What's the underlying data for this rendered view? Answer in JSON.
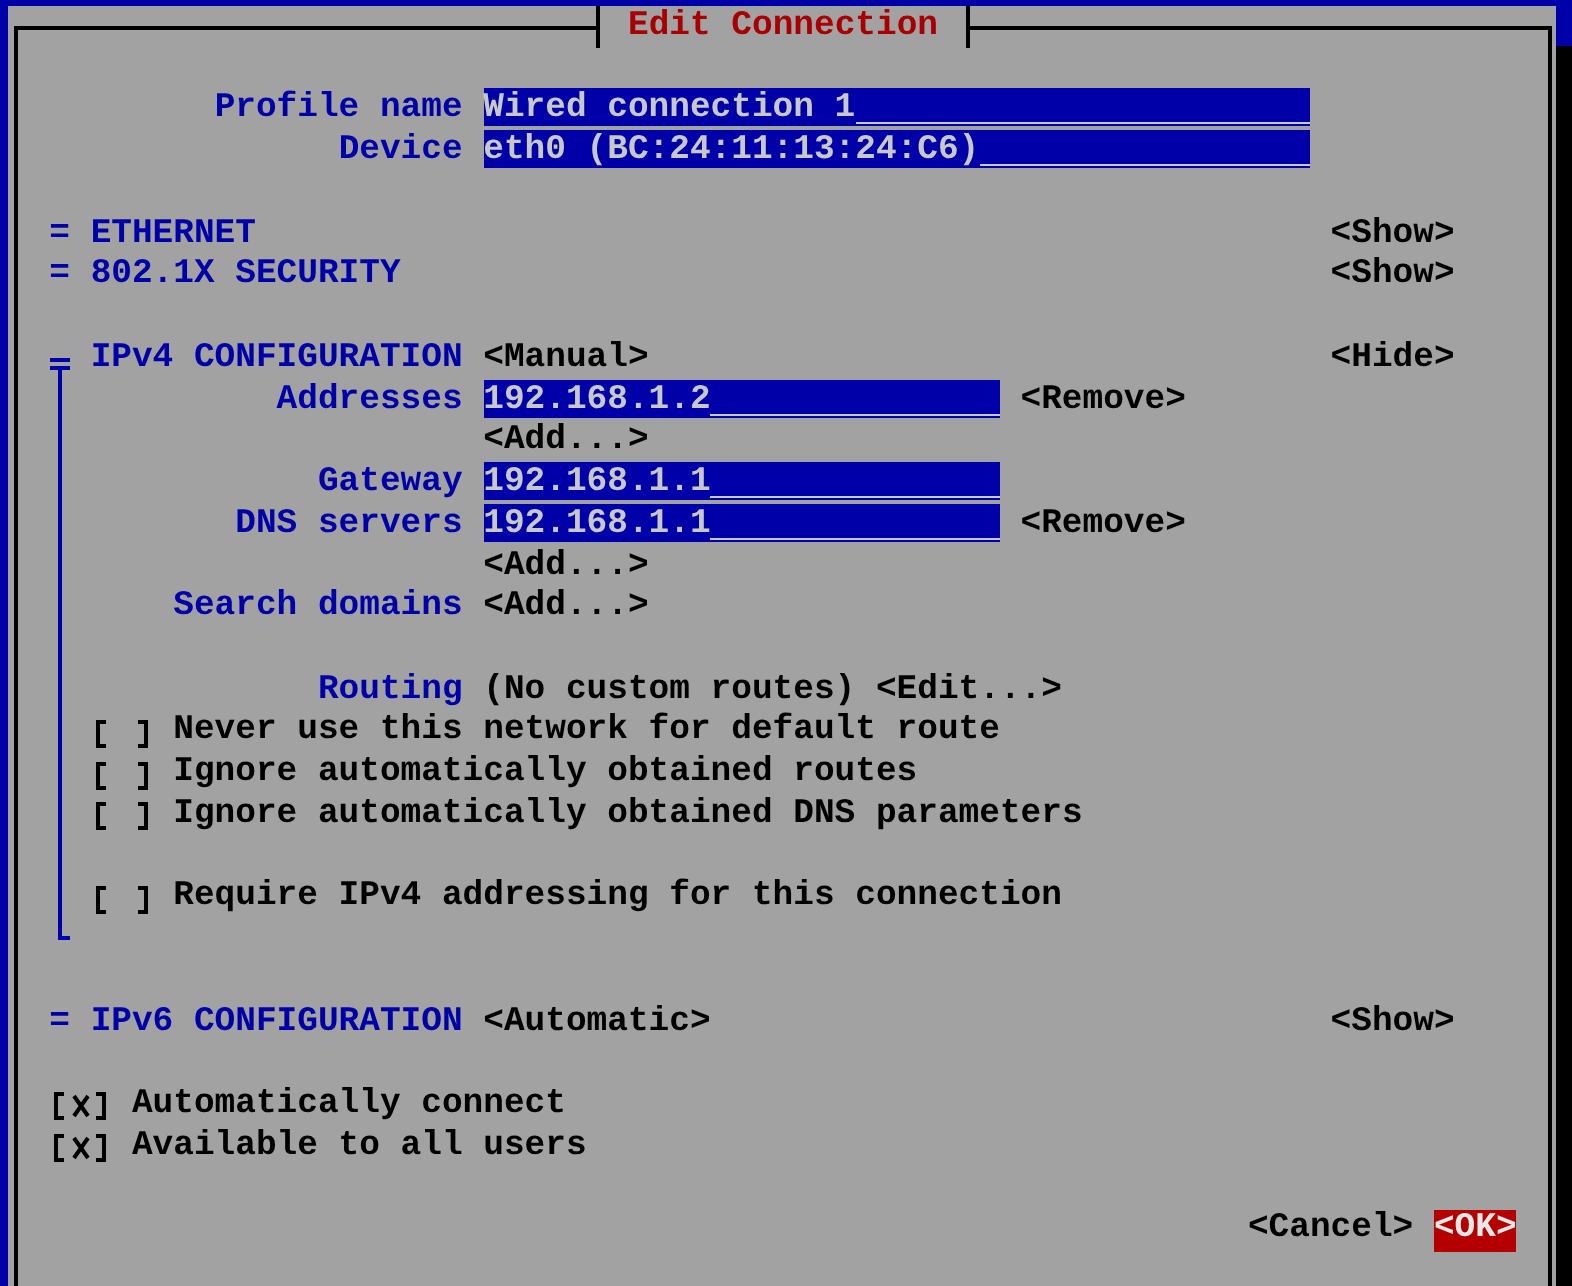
{
  "dialog": {
    "title": "Edit Connection"
  },
  "profile": [
    {
      "label": "Profile name",
      "value": "Wired connection 1"
    },
    {
      "label": "Device",
      "value": "eth0 (BC:24:11:13:24:C6)"
    }
  ],
  "sections": [
    {
      "marker": "=",
      "title": "ETHERNET",
      "toggle": "<Show>",
      "expanded": false
    },
    {
      "marker": "=",
      "title": "802.1X SECURITY",
      "toggle": "<Show>",
      "expanded": false
    },
    {
      "title": "IPv4 CONFIGURATION",
      "mode": "<Manual>",
      "toggle": "<Hide>",
      "expanded": true,
      "rows": [
        {
          "kind": "field",
          "label": "Addresses",
          "value": "192.168.1.2",
          "action": "<Remove>"
        },
        {
          "kind": "button",
          "text": "<Add...>"
        },
        {
          "kind": "field",
          "label": "Gateway",
          "value": "192.168.1.1"
        },
        {
          "kind": "field",
          "label": "DNS servers",
          "value": "192.168.1.1",
          "action": "<Remove>"
        },
        {
          "kind": "button",
          "text": "<Add...>"
        },
        {
          "kind": "button",
          "label": "Search domains",
          "text": "<Add...>"
        }
      ],
      "routing": {
        "label": "Routing",
        "value": "(No custom routes)",
        "button": "<Edit...>"
      },
      "option_groups": [
        {
          "options": [
            {
              "label": "Never use this network for default route",
              "checked": false
            },
            {
              "label": "Ignore automatically obtained routes",
              "checked": false
            },
            {
              "label": "Ignore automatically obtained DNS parameters",
              "checked": false
            }
          ]
        },
        {
          "options": [
            {
              "label": "Require IPv4 addressing for this connection",
              "checked": false
            }
          ]
        }
      ]
    },
    {
      "marker": "=",
      "title": "IPv6 CONFIGURATION",
      "mode": "<Automatic>",
      "toggle": "<Show>",
      "expanded": false
    }
  ],
  "options": [
    {
      "label": "Automatically connect",
      "checked": true
    },
    {
      "label": "Available to all users",
      "checked": true
    }
  ],
  "buttons": [
    {
      "label": "<Cancel>",
      "selected": false
    },
    {
      "label": "<OK>",
      "selected": true
    }
  ]
}
